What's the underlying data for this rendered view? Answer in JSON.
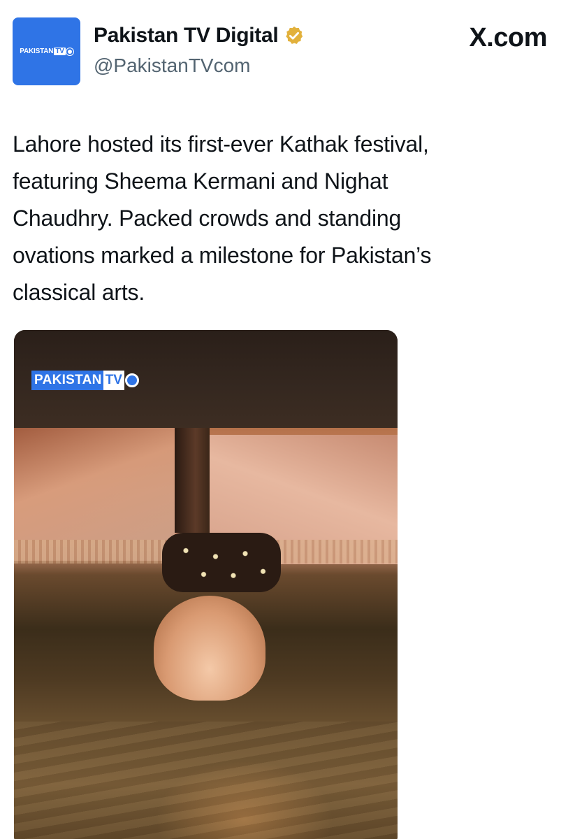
{
  "header": {
    "display_name": "Pakistan TV Digital",
    "handle": "@PakistanTVcom",
    "site_label": "X.com",
    "verified_badge_color": "#e2b13c",
    "avatar": {
      "brand": "PAKISTAN",
      "tv": "TV",
      "background_color": "#2f74e6"
    }
  },
  "tweet": {
    "lines": [
      "Lahore hosted its first-ever Kathak festival,",
      "featuring Sheema Kermani and Nighat",
      "Chaudhry. Packed crowds and standing",
      "ovations marked a milestone for Pakistan’s",
      "classical arts."
    ]
  },
  "media": {
    "watermark_brand": "PAKISTAN",
    "watermark_tv": "TV",
    "description_icon": "video-frame"
  }
}
